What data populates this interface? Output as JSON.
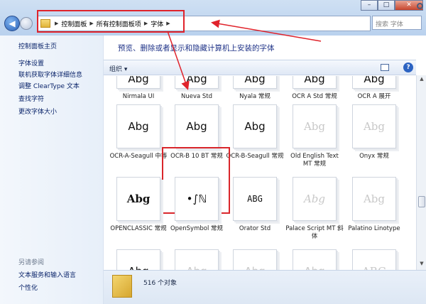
{
  "window": {
    "minimize": "–",
    "maximize": "□",
    "close": "✕"
  },
  "address": {
    "crumbs": [
      "控制面板",
      "所有控制面板项",
      "字体"
    ]
  },
  "search": {
    "placeholder": "搜索 字体"
  },
  "sidebar": {
    "home": "控制面板主页",
    "links": [
      "字体设置",
      "联机获取字体详细信息",
      "调整 ClearType 文本",
      "查找字符",
      "更改字体大小"
    ],
    "see_also": "另请参阅",
    "see_also_links": [
      "文本服务和输入语言",
      "个性化"
    ]
  },
  "main": {
    "heading": "预览、删除或者显示和隐藏计算机上安装的字体"
  },
  "toolbar": {
    "organize": "组织 ▾"
  },
  "fonts_row0": [
    {
      "preview": "Abg",
      "name": "Nirmala UI"
    },
    {
      "preview": "Abg",
      "name": "Nueva Std"
    },
    {
      "preview": "Abg",
      "name": "Nyala 常规"
    },
    {
      "preview": "Abg",
      "name": "OCR A Std 常规"
    },
    {
      "preview": "Abg",
      "name": "OCR A 展开"
    }
  ],
  "fonts_row1": [
    {
      "preview": "Abg",
      "name": "OCR-A-Seagull 中等"
    },
    {
      "preview": "Abg",
      "name": "OCR-B 10 BT 常规"
    },
    {
      "preview": "Abg",
      "name": "OCR-B-Seagull 常规"
    },
    {
      "preview": "Abg",
      "name": "Old English Text MT 常规"
    },
    {
      "preview": "Abg",
      "name": "Onyx 常规"
    }
  ],
  "fonts_row2": [
    {
      "preview": "Abg",
      "name": "OPENCLASSIC 常规"
    },
    {
      "preview": "•∫ℕ",
      "name": "OpenSymbol 常规"
    },
    {
      "preview": "ABG",
      "name": "Orator Std"
    },
    {
      "preview": "Abg",
      "name": "Palace Script MT 斜体"
    },
    {
      "preview": "Abg",
      "name": "Palatino Linotype"
    }
  ],
  "fonts_row3": [
    {
      "preview": "Abg"
    },
    {
      "preview": "Abg"
    },
    {
      "preview": "Abg"
    },
    {
      "preview": "Abg"
    },
    {
      "preview": "ABG"
    }
  ],
  "status": {
    "count": "516 个对象"
  },
  "colors": {
    "highlight": "#e0232b",
    "link": "#0a246a"
  }
}
